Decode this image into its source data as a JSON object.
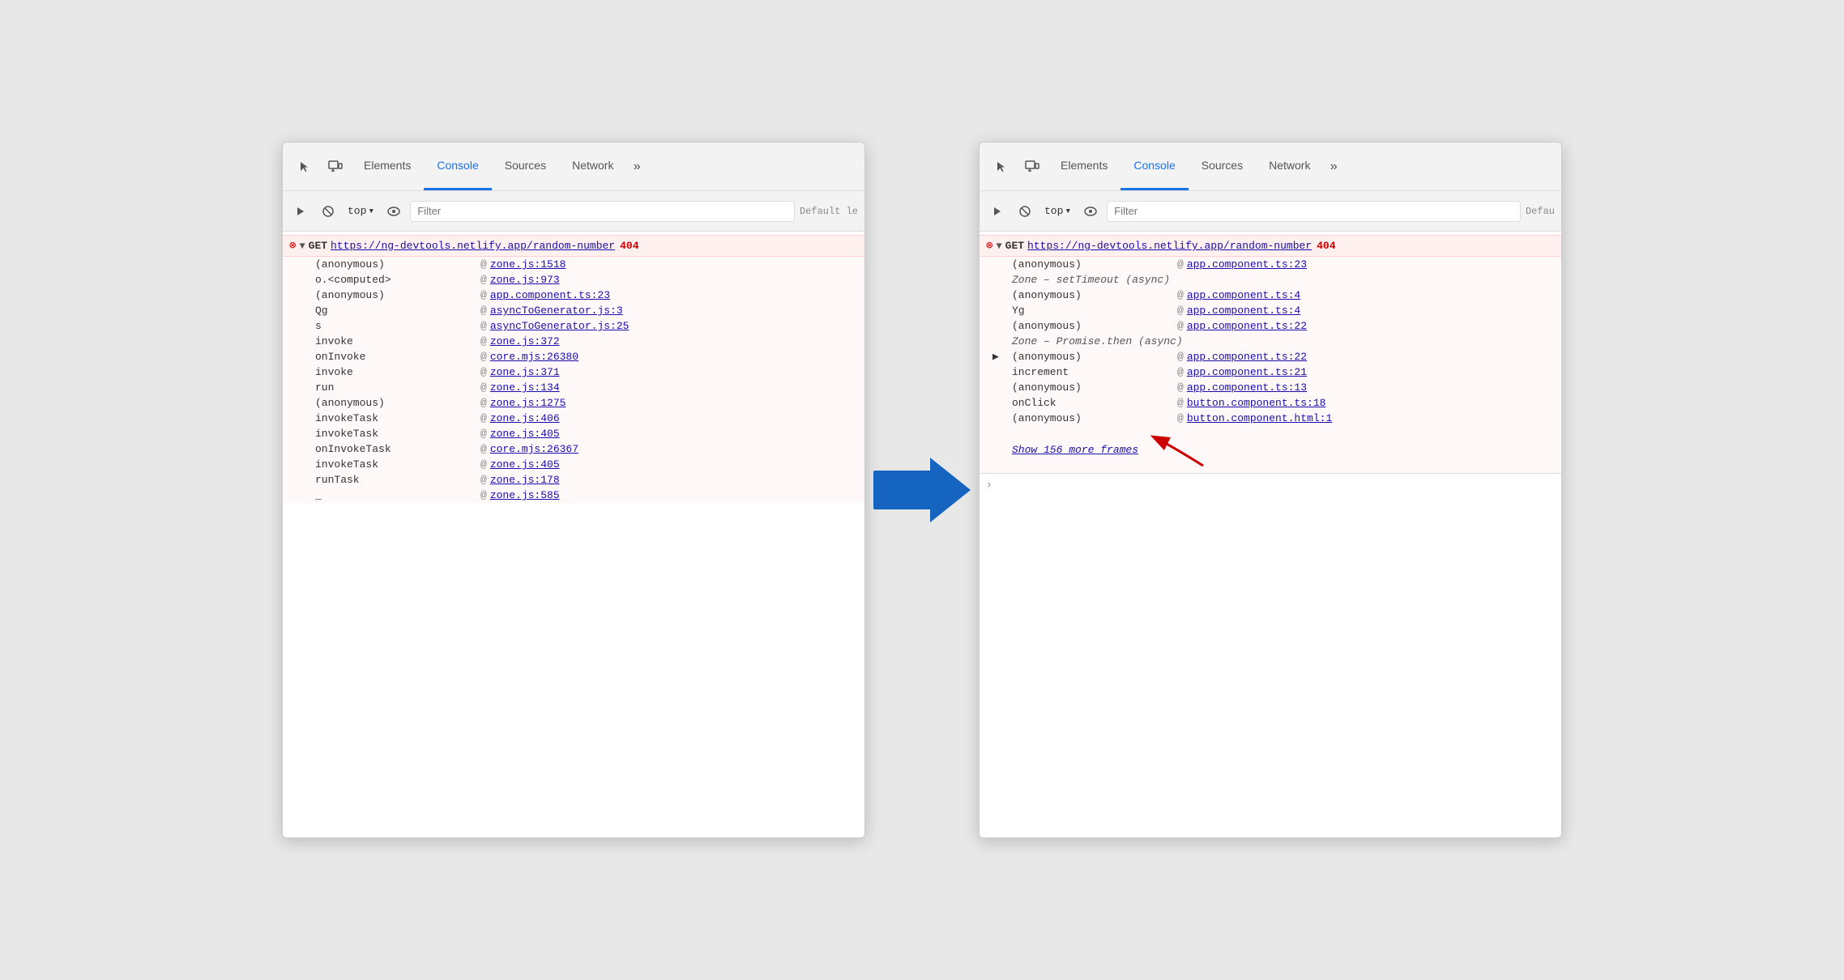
{
  "left_panel": {
    "tabs": [
      {
        "label": "Elements",
        "active": false
      },
      {
        "label": "Console",
        "active": true
      },
      {
        "label": "Sources",
        "active": false
      },
      {
        "label": "Network",
        "active": false
      },
      {
        "label": "»",
        "active": false
      }
    ],
    "toolbar": {
      "top_label": "top",
      "filter_placeholder": "Filter",
      "default_level_label": "Default le"
    },
    "error": {
      "method": "GET",
      "url": "https://ng-devtools.netlify.app/random-number",
      "status": "404"
    },
    "stack_frames": [
      {
        "fn": "(anonymous)",
        "at_label": "@",
        "link": "zone.js:1518",
        "italic": false
      },
      {
        "fn": "o.<computed>",
        "at_label": "@",
        "link": "zone.js:973",
        "italic": false
      },
      {
        "fn": "(anonymous)",
        "at_label": "@",
        "link": "app.component.ts:23",
        "italic": false
      },
      {
        "fn": "Qg",
        "at_label": "@",
        "link": "asyncToGenerator.js:3",
        "italic": false
      },
      {
        "fn": "s",
        "at_label": "@",
        "link": "asyncToGenerator.js:25",
        "italic": false
      },
      {
        "fn": "invoke",
        "at_label": "@",
        "link": "zone.js:372",
        "italic": false
      },
      {
        "fn": "onInvoke",
        "at_label": "@",
        "link": "core.mjs:26380",
        "italic": false
      },
      {
        "fn": "invoke",
        "at_label": "@",
        "link": "zone.js:371",
        "italic": false
      },
      {
        "fn": "run",
        "at_label": "@",
        "link": "zone.js:134",
        "italic": false
      },
      {
        "fn": "(anonymous)",
        "at_label": "@",
        "link": "zone.js:1275",
        "italic": false
      },
      {
        "fn": "invokeTask",
        "at_label": "@",
        "link": "zone.js:406",
        "italic": false
      },
      {
        "fn": "invokeTask",
        "at_label": "@",
        "link": "zone.js:405",
        "italic": false
      },
      {
        "fn": "onInvokeTask",
        "at_label": "@",
        "link": "core.mjs:26367",
        "italic": false
      },
      {
        "fn": "invokeTask",
        "at_label": "@",
        "link": "zone.js:405",
        "italic": false
      },
      {
        "fn": "runTask",
        "at_label": "@",
        "link": "zone.js:178",
        "italic": false
      },
      {
        "fn": "_",
        "at_label": "@",
        "link": "zone.js:585",
        "italic": false
      }
    ]
  },
  "right_panel": {
    "tabs": [
      {
        "label": "Elements",
        "active": false
      },
      {
        "label": "Console",
        "active": true
      },
      {
        "label": "Sources",
        "active": false
      },
      {
        "label": "Network",
        "active": false
      },
      {
        "label": "»",
        "active": false
      }
    ],
    "toolbar": {
      "top_label": "top",
      "filter_placeholder": "Filter",
      "default_level_label": "Defau"
    },
    "error": {
      "method": "GET",
      "url": "https://ng-devtools.netlify.app/random-number",
      "status": "404"
    },
    "stack_frames": [
      {
        "fn": "(anonymous)",
        "at_label": "@",
        "link": "app.component.ts:23",
        "italic": false
      },
      {
        "fn": "Zone – setTimeout (async)",
        "italic": true
      },
      {
        "fn": "(anonymous)",
        "at_label": "@",
        "link": "app.component.ts:4",
        "italic": false
      },
      {
        "fn": "Yg",
        "at_label": "@",
        "link": "app.component.ts:4",
        "italic": false
      },
      {
        "fn": "(anonymous)",
        "at_label": "@",
        "link": "app.component.ts:22",
        "italic": false
      },
      {
        "fn": "Zone – Promise.then (async)",
        "italic": true
      },
      {
        "fn": "(anonymous)",
        "at_label": "@",
        "link": "app.component.ts:22",
        "italic": false
      },
      {
        "fn": "increment",
        "at_label": "@",
        "link": "app.component.ts:21",
        "italic": false
      },
      {
        "fn": "(anonymous)",
        "at_label": "@",
        "link": "app.component.ts:13",
        "italic": false
      },
      {
        "fn": "onClick",
        "at_label": "@",
        "link": "button.component.ts:18",
        "italic": false
      },
      {
        "fn": "(anonymous)",
        "at_label": "@",
        "link": "button.component.html:1",
        "italic": false
      }
    ],
    "show_more": "Show 156 more frames"
  }
}
